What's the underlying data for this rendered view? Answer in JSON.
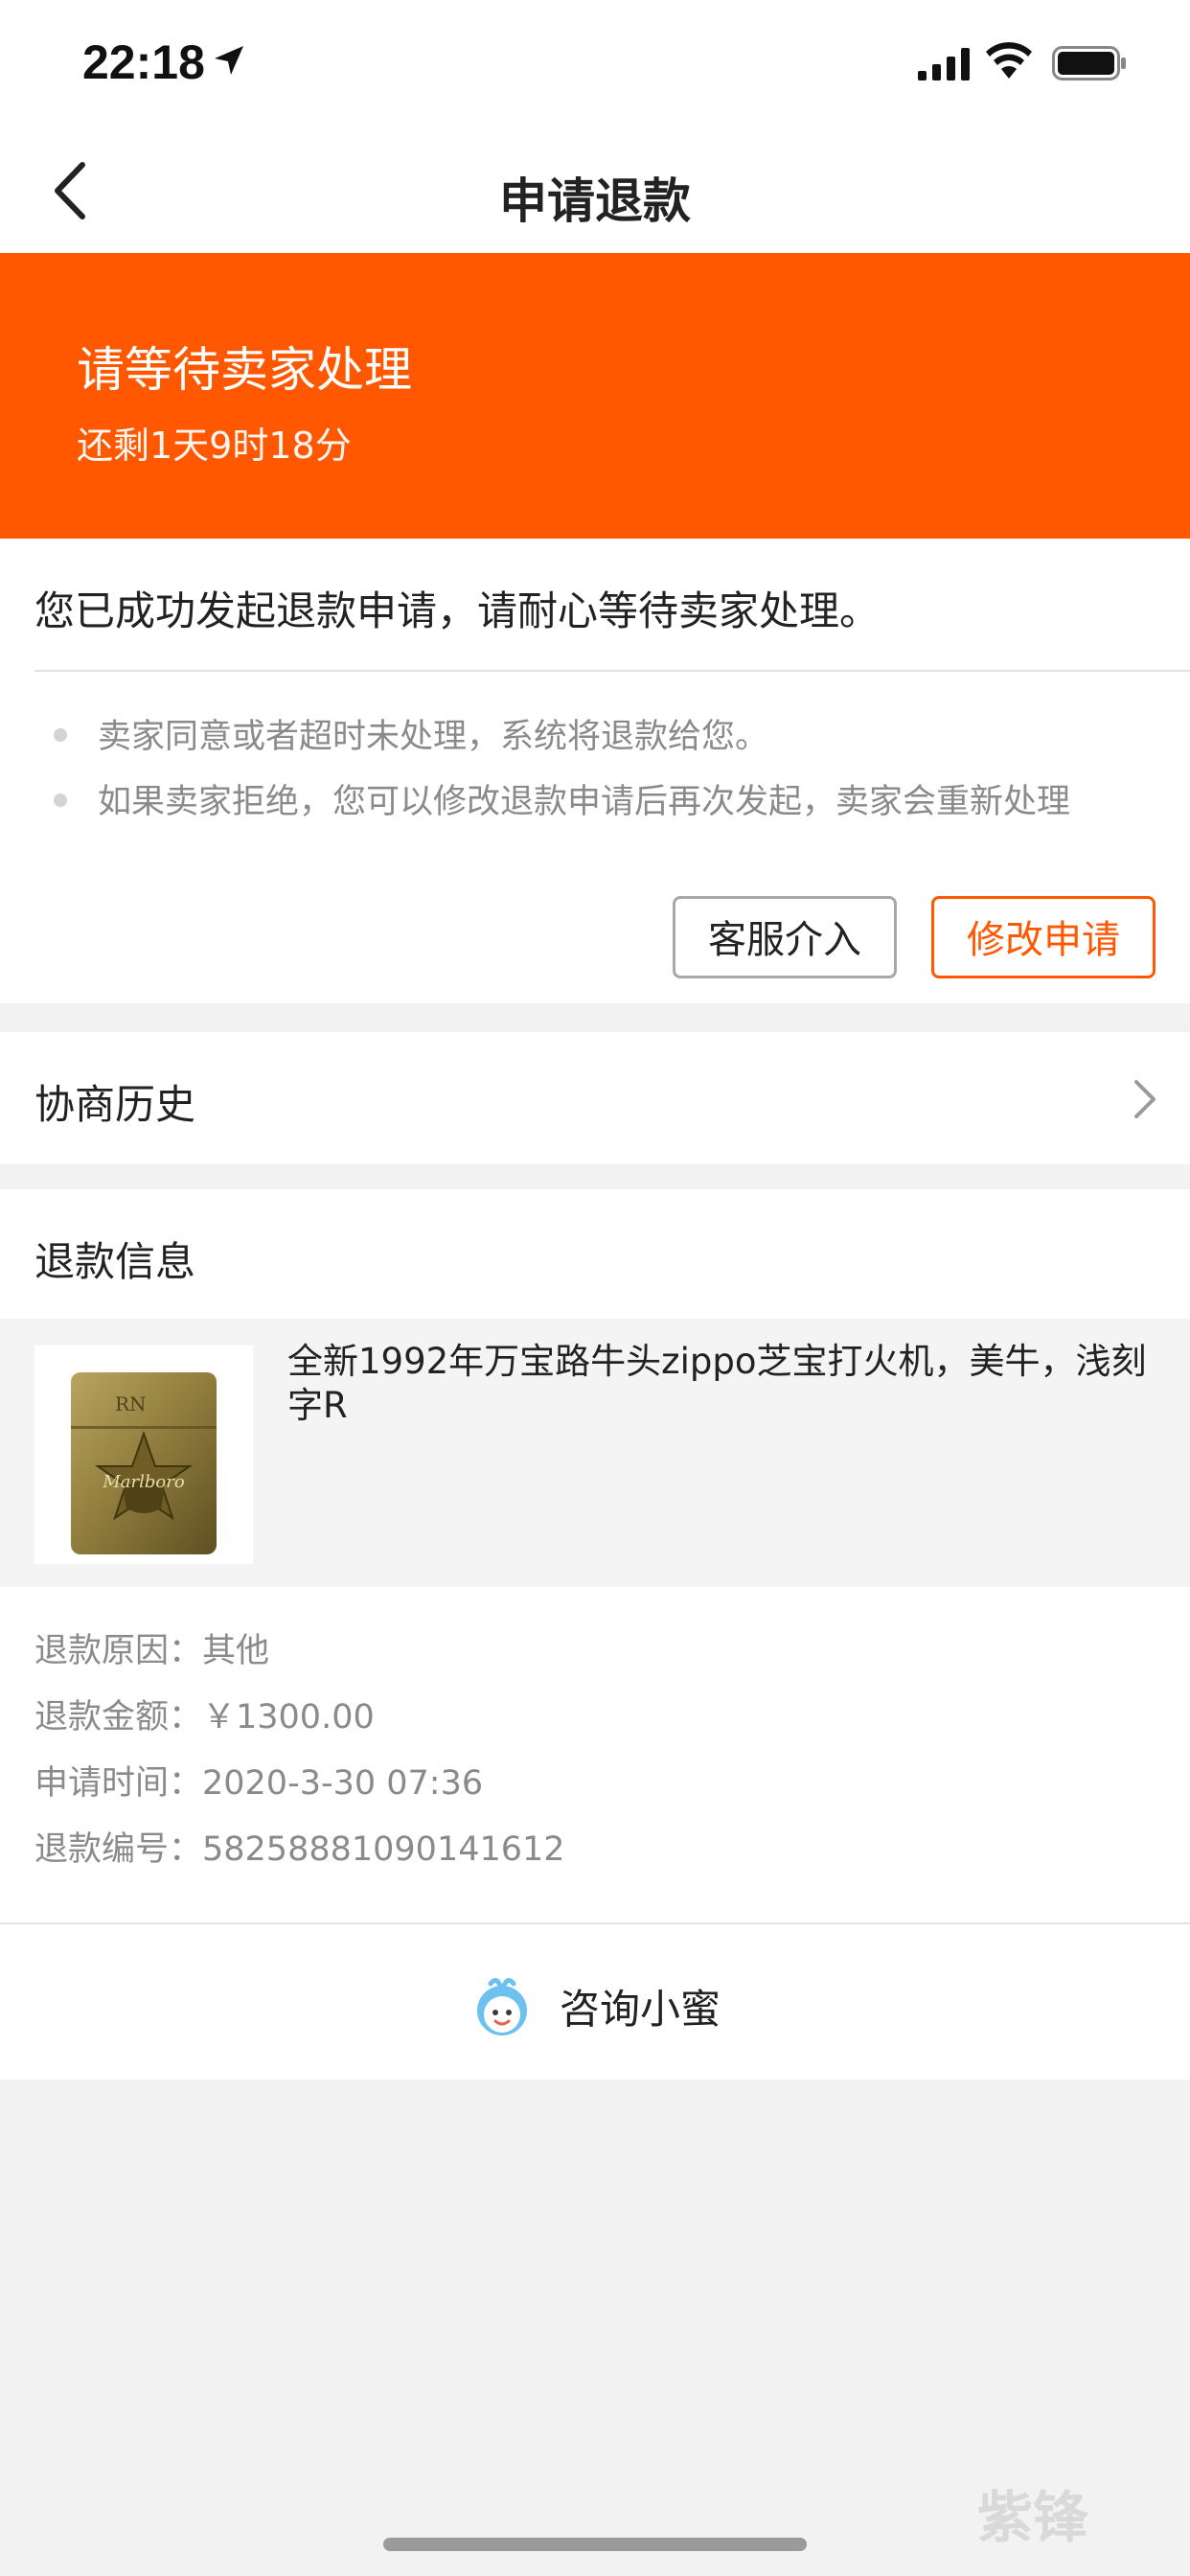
{
  "status_bar": {
    "time": "22:18"
  },
  "nav": {
    "title": "申请退款"
  },
  "banner": {
    "title": "请等待卖家处理",
    "subtitle": "还剩1天9时18分",
    "color": "#ff5800"
  },
  "status_card": {
    "message": "您已成功发起退款申请，请耐心等待卖家处理。",
    "bullets": [
      "卖家同意或者超时未处理，系统将退款给您。",
      "如果卖家拒绝，您可以修改退款申请后再次发起，卖家会重新处理"
    ],
    "buttons": {
      "service": "客服介入",
      "modify": "修改申请"
    }
  },
  "history": {
    "label": "协商历史"
  },
  "refund_info": {
    "title": "退款信息",
    "product_name": "全新1992年万宝路牛头zippo芝宝打火机，美牛，浅刻字R",
    "product_engraving": "RN",
    "product_logo": "Marlboro",
    "reason": "退款原因：其他",
    "amount": "退款金额：￥1300.00",
    "time": "申请时间：2020-3-30 07:36",
    "number": "退款编号：58258881090141612"
  },
  "consult": {
    "label": "咨询小蜜"
  },
  "watermark": "紫锋"
}
